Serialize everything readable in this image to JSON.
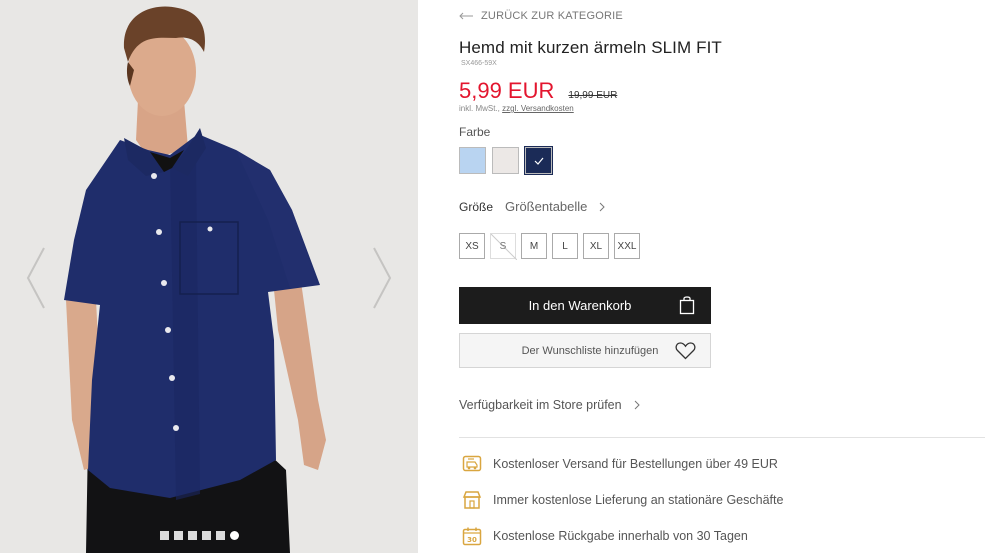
{
  "gallery": {
    "dots_count": 6,
    "active_dot": 5
  },
  "product": {
    "back_link": "ZURÜCK ZUR KATEGORIE",
    "title": "Hemd mit kurzen ärmeln SLIM FIT",
    "sku": "SX466-59X",
    "price_new": "5,99 EUR",
    "price_old": "19,99 EUR",
    "tax_text": "inkl. MwSt.,",
    "shipping_link": "zzgl. Versandkosten",
    "color_label": "Farbe",
    "colors": [
      {
        "name": "light-blue",
        "hex": "#b9d4f1",
        "selected": false
      },
      {
        "name": "light-grey",
        "hex": "#ece8e6",
        "selected": false
      },
      {
        "name": "navy",
        "hex": "#1b2b57",
        "selected": true
      }
    ],
    "size_label": "Größe",
    "size_table": "Größentabelle",
    "sizes": [
      {
        "label": "XS",
        "available": true
      },
      {
        "label": "S",
        "available": false
      },
      {
        "label": "M",
        "available": true
      },
      {
        "label": "L",
        "available": true
      },
      {
        "label": "XL",
        "available": true
      },
      {
        "label": "XXL",
        "available": true
      }
    ],
    "cart_button": "In den Warenkorb",
    "wishlist_button": "Der Wunschliste hinzufügen",
    "store_check": "Verfügbarkeit im Store prüfen"
  },
  "benefits": [
    {
      "icon": "free-shipping-icon",
      "text": "Kostenloser Versand für Bestellungen über 49 EUR"
    },
    {
      "icon": "store-icon",
      "text": "Immer kostenlose Lieferung an stationäre Geschäfte"
    },
    {
      "icon": "calendar-30-icon",
      "text": "Kostenlose Rückgabe innerhalb von 30 Tagen"
    }
  ],
  "colors": {
    "accent_price": "#e3152e",
    "button_dark": "#1c1c1c",
    "benefit_icon": "#d9a640"
  }
}
